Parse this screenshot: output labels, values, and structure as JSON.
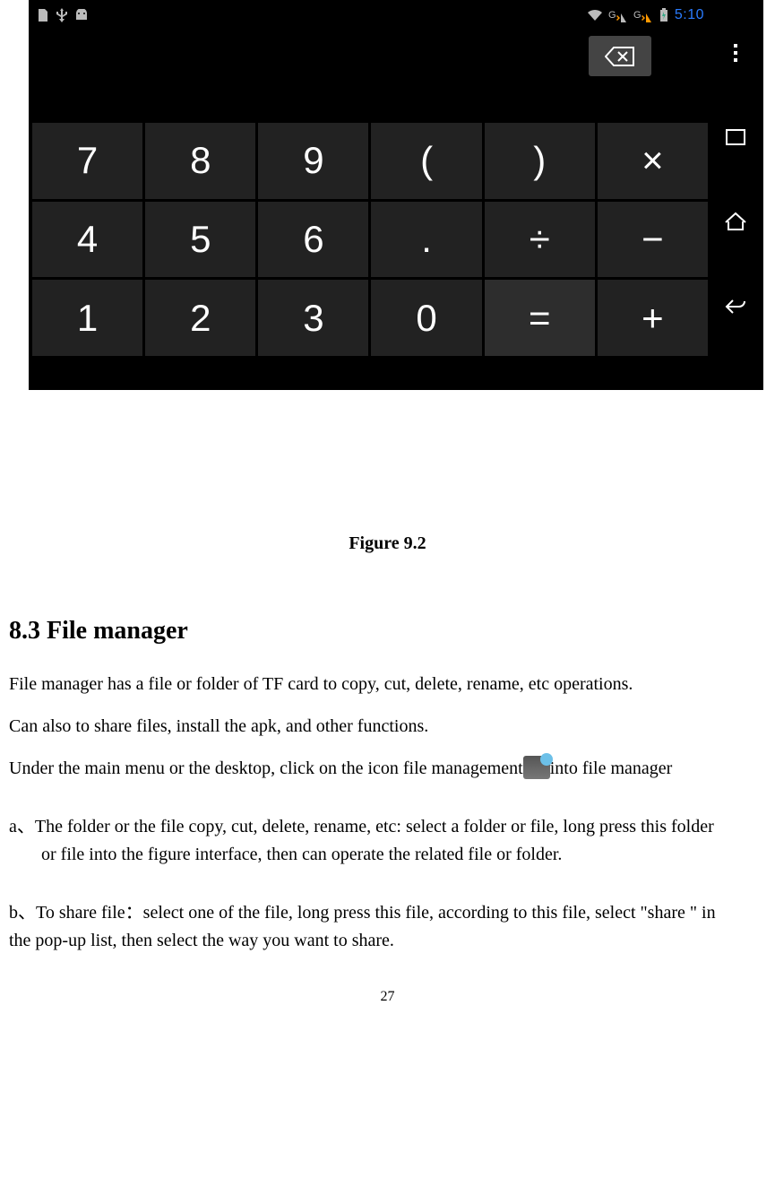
{
  "statusbar": {
    "clock": "5:10"
  },
  "calculator": {
    "keys_row1": [
      "7",
      "8",
      "9",
      "(",
      ")",
      "×"
    ],
    "keys_row2": [
      "4",
      "5",
      "6",
      ".",
      "÷",
      "−"
    ],
    "keys_row3": [
      "1",
      "2",
      "3",
      "0",
      "=",
      "+"
    ]
  },
  "caption": "Figure 9.2",
  "section_heading": "8.3 File manager",
  "para1": "File manager has a file or folder of TF card to copy, cut, delete, rename, etc operations.",
  "para2": "Can also to share files, install the apk, and other functions.",
  "para3_pre": "Under the main menu or the desktop, click on the icon file management",
  "para3_post": "into file manager",
  "para_a_label": "a、",
  "para_a_text": "The folder or the file copy, cut, delete, rename, etc: select a folder or file, long press this folder",
  "para_a_cont": "or file into the figure interface, then can operate the related file or folder.",
  "para_b_label": "b、",
  "para_b_text": "To share file：select one of the file, long press this file, according to this file, select \"share \" in",
  "para_b_cont": "the pop-up list, then select the way you want to share.",
  "page_number": "27"
}
